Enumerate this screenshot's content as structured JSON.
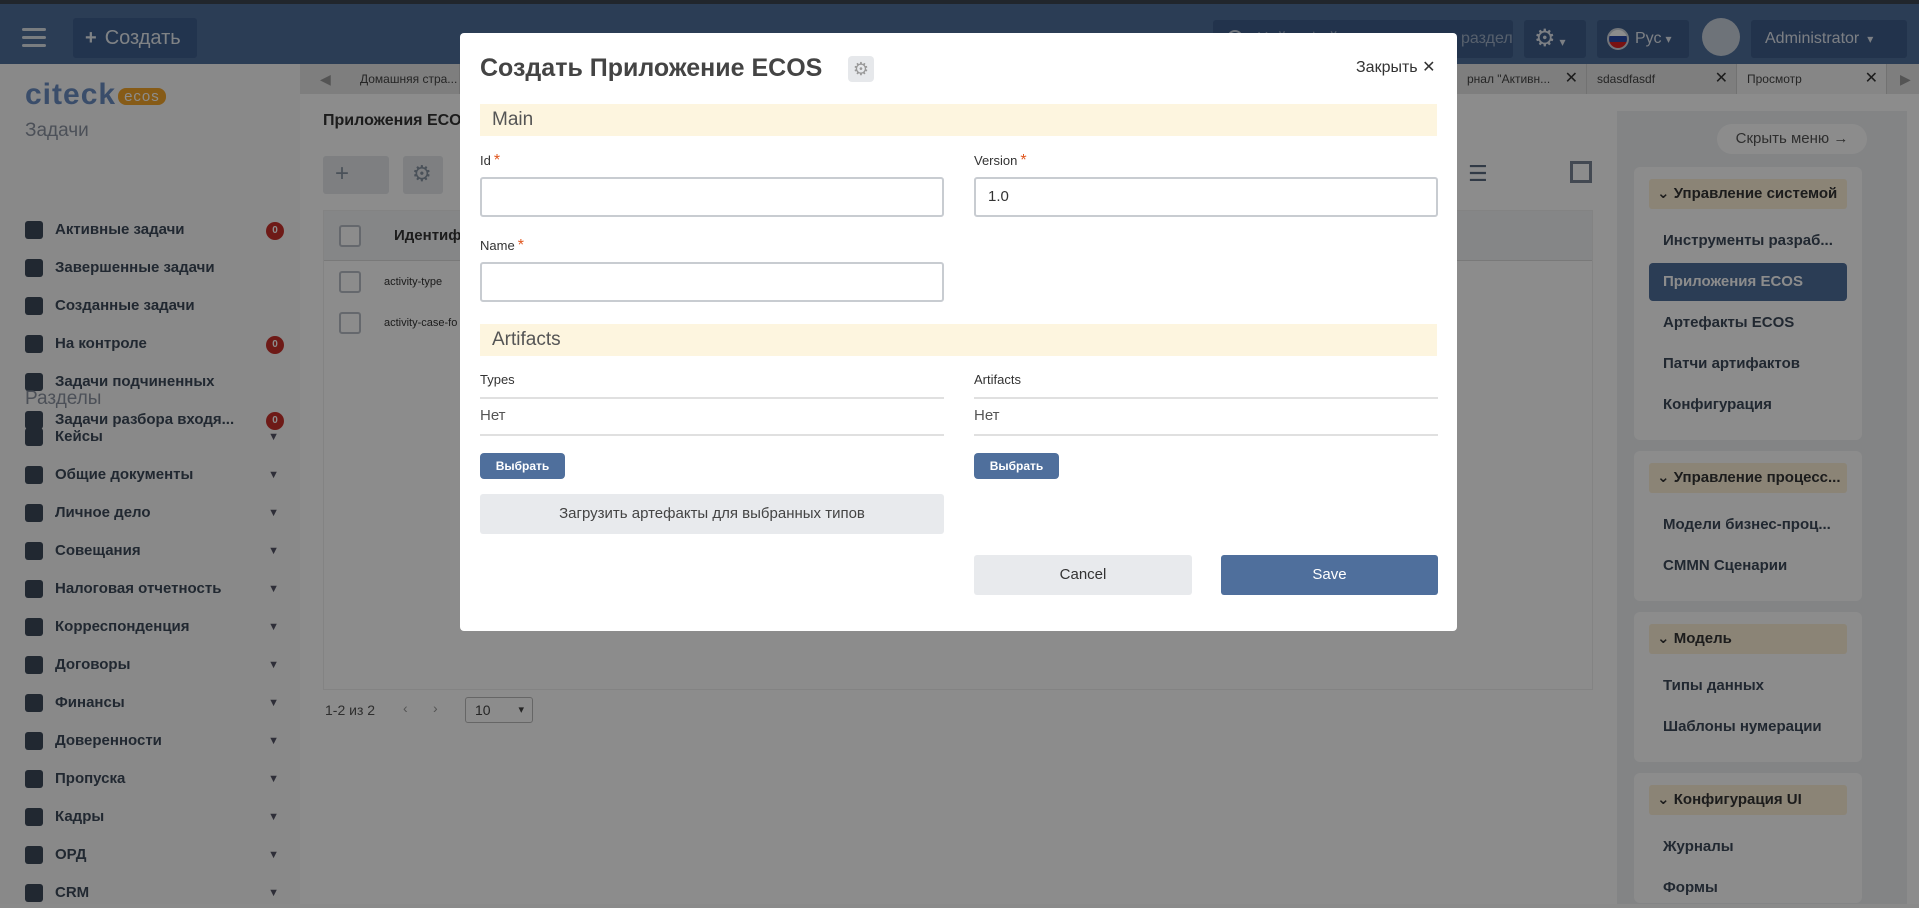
{
  "topbar": {
    "create_label": "Создать",
    "search_placeholder": "Найти файл, человека или раздел",
    "lang_label": "Рус",
    "user_label": "Administrator"
  },
  "sidebar": {
    "logo_text": "citeck",
    "logo_badge": "ecos",
    "section_tasks": "Задачи",
    "tasks": [
      {
        "label": "Активные задачи",
        "badge": "0"
      },
      {
        "label": "Завершенные задачи"
      },
      {
        "label": "Созданные задачи"
      },
      {
        "label": "На контроле",
        "badge": "0"
      },
      {
        "label": "Задачи подчиненных"
      },
      {
        "label": "Задачи разбора входя...",
        "badge": "0"
      }
    ],
    "section_sections": "Разделы",
    "sections": [
      {
        "label": "Кейсы"
      },
      {
        "label": "Общие документы"
      },
      {
        "label": "Личное дело"
      },
      {
        "label": "Совещания"
      },
      {
        "label": "Налоговая отчетность"
      },
      {
        "label": "Корреспонденция"
      },
      {
        "label": "Договоры"
      },
      {
        "label": "Финансы"
      },
      {
        "label": "Доверенности"
      },
      {
        "label": "Пропуска"
      },
      {
        "label": "Кадры"
      },
      {
        "label": "ОРД"
      },
      {
        "label": "CRM"
      }
    ]
  },
  "tabs": [
    {
      "label": "Домашняя стра..."
    },
    {
      "label": "рнал \"Активн..."
    },
    {
      "label": "sdasdfasdf"
    },
    {
      "label": "Просмотр"
    }
  ],
  "journal": {
    "title": "Приложения ECOS",
    "column_header": "Идентиф",
    "rows": [
      "activity-type",
      "activity-case-fo"
    ],
    "pager_text": "1-2 из 2",
    "page_size": "10"
  },
  "right_menu": {
    "hide_label": "Скрыть меню →",
    "groups": [
      {
        "title": "Управление системой",
        "items": [
          "Инструменты разраб...",
          "Приложения ECOS",
          "Артефакты ECOS",
          "Патчи артифактов",
          "Конфигурация"
        ]
      },
      {
        "title": "Управление процесс...",
        "items": [
          "Модели бизнес-проц...",
          "CMMN Сценарии"
        ]
      },
      {
        "title": "Модель",
        "items": [
          "Типы данных",
          "Шаблоны нумерации"
        ]
      },
      {
        "title": "Конфигурация UI",
        "items": [
          "Журналы",
          "Формы"
        ]
      }
    ]
  },
  "modal": {
    "title": "Создать Приложение ECOS",
    "close_label": "Закрыть ✕",
    "panel_main": "Main",
    "id_label": "Id",
    "id_value": "",
    "version_label": "Version",
    "version_value": "1.0",
    "name_label": "Name",
    "name_value": "",
    "panel_artifacts": "Artifacts",
    "types_label": "Types",
    "types_value": "Нет",
    "artifacts_label": "Artifacts",
    "artifacts_value": "Нет",
    "select_label": "Выбрать",
    "load_label": "Загрузить артефакты для выбранных типов",
    "cancel_label": "Cancel",
    "save_label": "Save"
  }
}
